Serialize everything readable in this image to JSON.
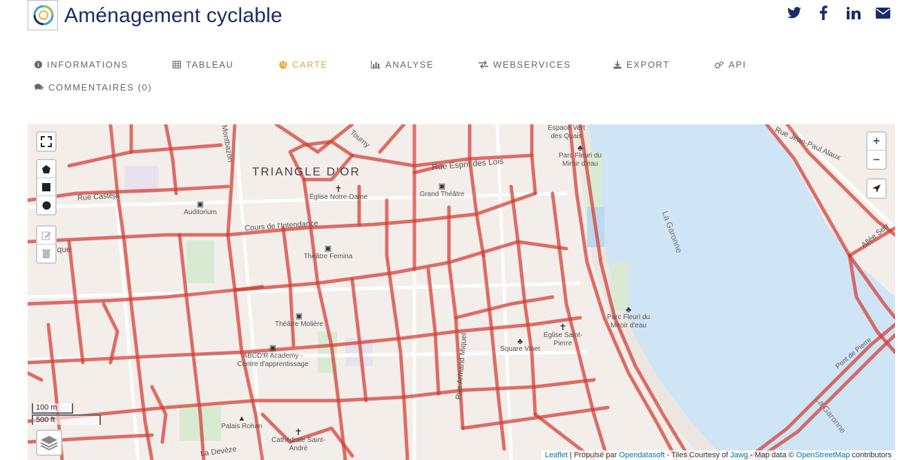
{
  "header": {
    "title": "Aménagement cyclable",
    "social": [
      "twitter-icon",
      "facebook-icon",
      "linkedin-icon",
      "email-icon"
    ]
  },
  "nav": {
    "tabs": [
      {
        "label": "INFORMATIONS",
        "icon": "info-icon",
        "active": false
      },
      {
        "label": "TABLEAU",
        "icon": "table-icon",
        "active": false
      },
      {
        "label": "CARTE",
        "icon": "globe-icon",
        "active": true
      },
      {
        "label": "ANALYSE",
        "icon": "chart-icon",
        "active": false
      },
      {
        "label": "WEBSERVICES",
        "icon": "exchange-icon",
        "active": false
      },
      {
        "label": "EXPORT",
        "icon": "download-icon",
        "active": false
      },
      {
        "label": "API",
        "icon": "cogs-icon",
        "active": false
      },
      {
        "label": "COMMENTAIRES (0)",
        "icon": "comments-icon",
        "active": false
      }
    ],
    "active_color": "#e2a93a"
  },
  "map": {
    "labels": {
      "triangle": "TRIANGLE D'OR",
      "garonne1": "La Garonne",
      "garonne2": "La Garonne",
      "rue_esprit": "Rue Esprit des Lois",
      "rue_castera": "Rue Castéja",
      "cours_intendance": "Cours de l'Intendance",
      "rue_jean_paul": "Rue Jean-Paul Alaux",
      "allee_serr": "Allée Serr",
      "pont_pierre": "Pont de Pierre",
      "rue_armand": "Rue Armand Miquel",
      "rue_tourny": "Tourny",
      "rue_deveze": "La Devèze",
      "rue_judaique": "daïque",
      "montbazon": "Montbazon",
      "auditorium": "Auditorium",
      "eglise_notre": "Église Notre-Dame",
      "grand_theatre": "Grand Théâtre",
      "theatre_femina": "Théâtre Femina",
      "theatre_moliere": "Théâtre Molière",
      "abcdr": "ABCD'R Academy - Centre d'apprentissage",
      "square_vinet": "Square Vinet",
      "eglise_saint_pierre": "Église Saint-Pierre",
      "parc_fleuri1": "Parc Fleuri du Miroir d'eau",
      "parc_fleuri2": "Parc Fleuri du Miroir d'eau",
      "espace_vert": "Espace Vert des Quais",
      "palais_rohan": "Palais Rohan",
      "cathedrale": "Cathédrale Saint-André"
    },
    "scale": {
      "metric": "100 m",
      "imperial": "500 ft"
    },
    "attribution": {
      "leaflet": "Leaflet",
      "propulse": "| Propulsé par",
      "ods": "Opendatasoft",
      "tiles": "- Tiles Courtesy of",
      "jawg": "Jawg",
      "mapdata": "- Map data ©",
      "osm": "OpenStreetMap",
      "contributors": "contributors"
    },
    "controls": {
      "zoom_in": "+",
      "zoom_out": "−"
    },
    "colors": {
      "land": "#f3eeea",
      "water": "#cfe4f5",
      "park": "#d9ead2",
      "cycle_route": "#d23c32"
    }
  }
}
